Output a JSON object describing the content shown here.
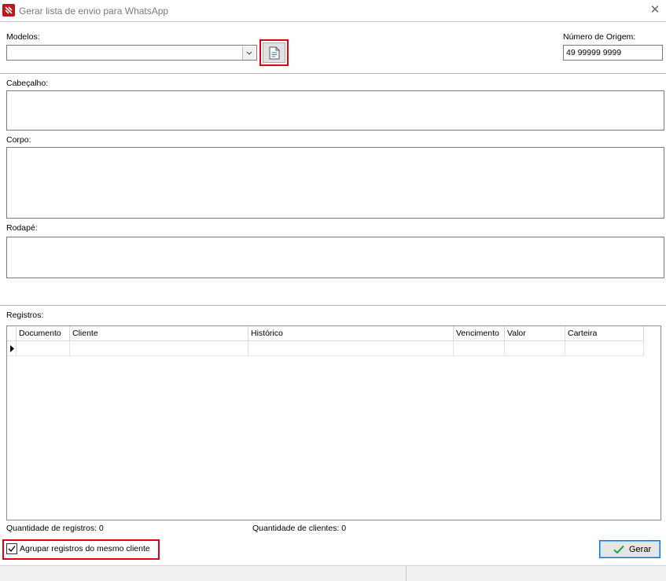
{
  "window": {
    "title": "Gerar lista de envio para WhatsApp",
    "close_glyph": "✕"
  },
  "modelos": {
    "label": "Modelos:",
    "value": "",
    "button_icon": "document-icon"
  },
  "origem": {
    "label": "Número de Origem:",
    "value": "49 99999 9999"
  },
  "cabecalho": {
    "label": "Cabeçalho:",
    "value": ""
  },
  "corpo": {
    "label": "Corpo:",
    "value": ""
  },
  "rodape": {
    "label": "Rodapé:",
    "value": ""
  },
  "registros": {
    "label": "Registros:",
    "columns": [
      "Documento",
      "Cliente",
      "Histórico",
      "Vencimento",
      "Valor",
      "Carteira"
    ],
    "rows": []
  },
  "footer": {
    "qtd_registros": "Quantidade de registros: 0",
    "qtd_clientes": "Quantidade de clientes: 0",
    "agrupar_label": "Agrupar registros do mesmo cliente",
    "agrupar_checked": true,
    "gerar_label": "Gerar"
  },
  "colors": {
    "highlight": "#e2000f",
    "accent": "#0078d7",
    "check_green": "#1f9e3e"
  }
}
